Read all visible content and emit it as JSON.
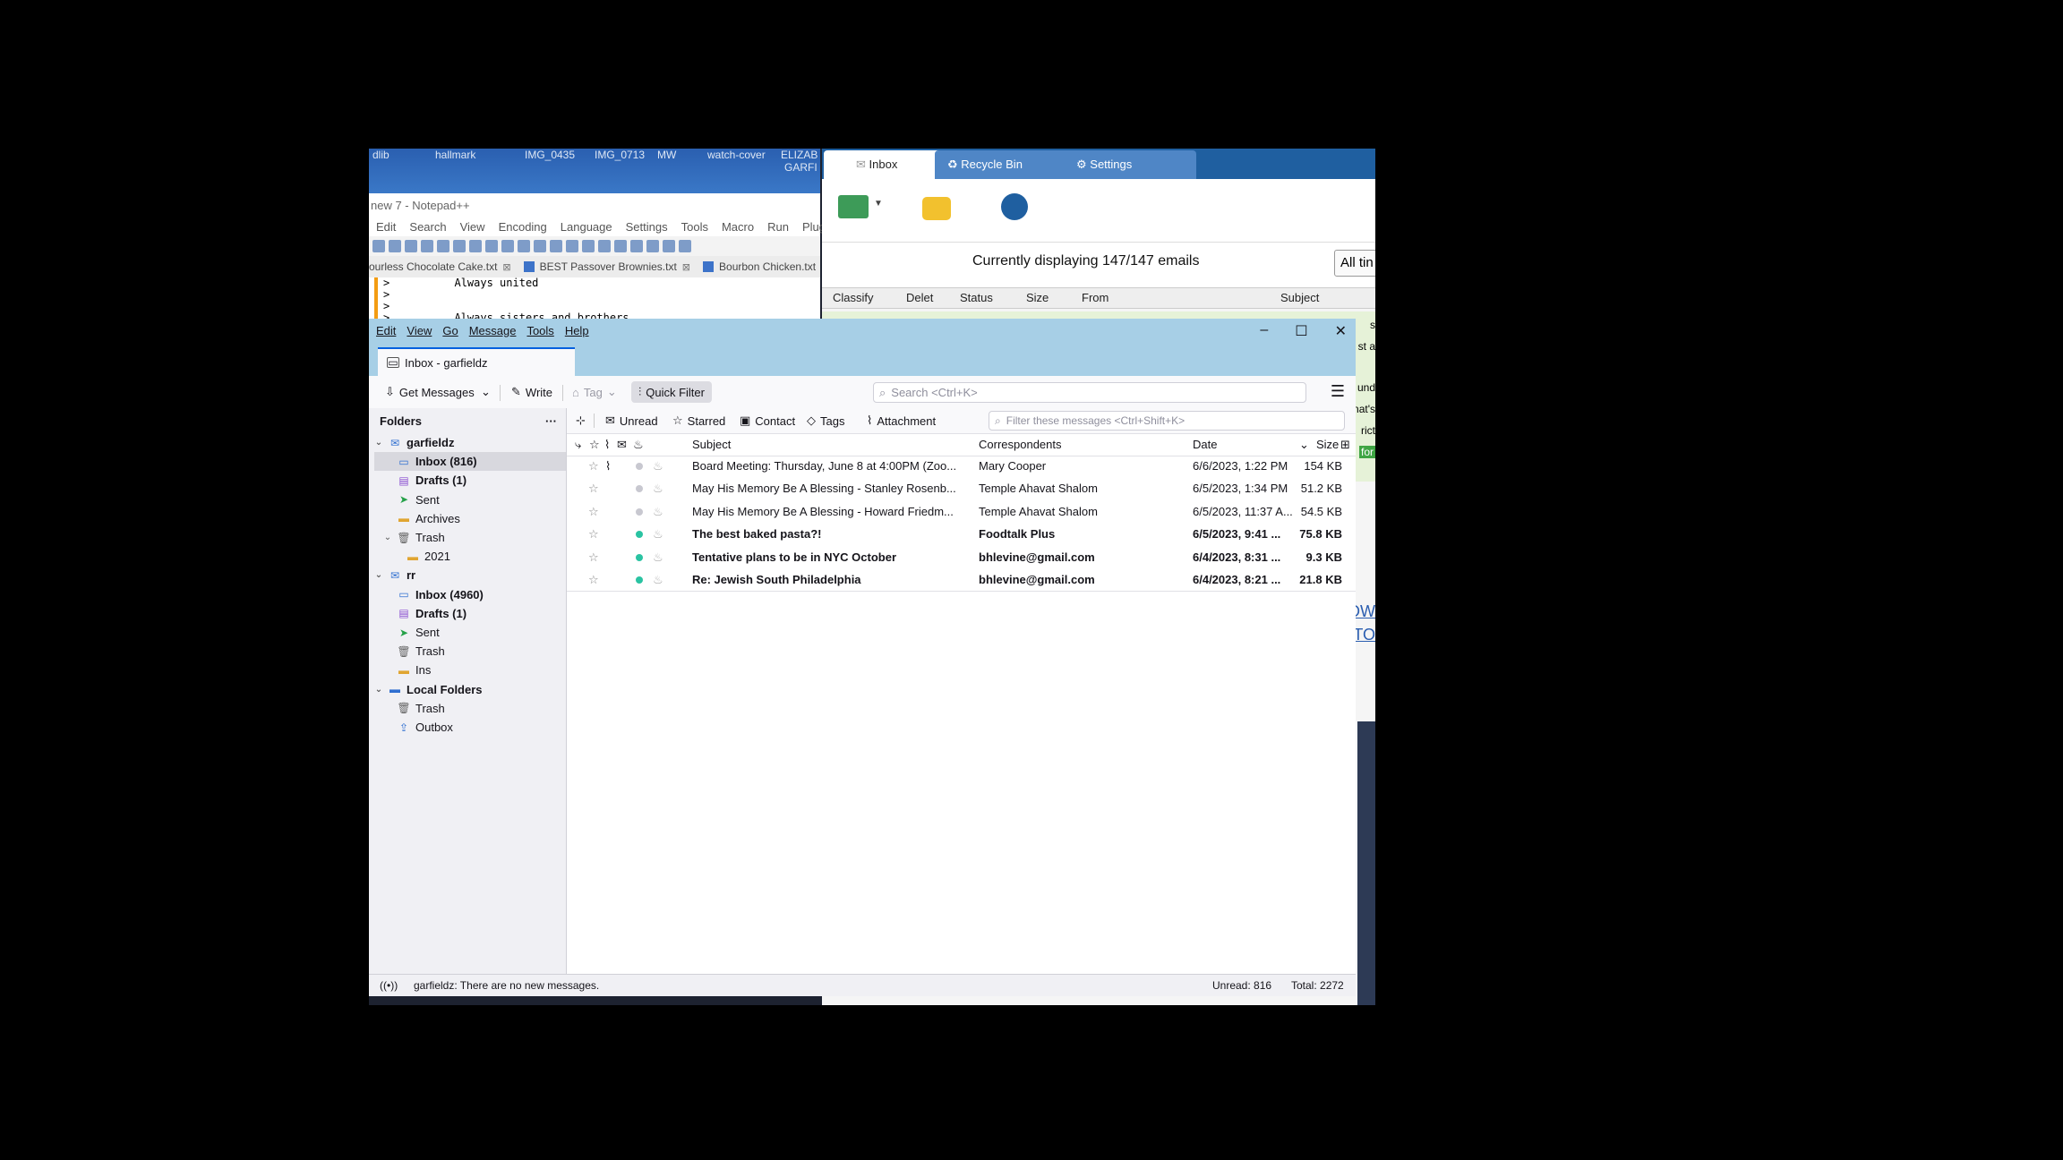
{
  "background": {
    "desktop_labels": [
      "dlib",
      "hallmark",
      "IMG_0435",
      "IMG_0713",
      "MW",
      "watch-cover",
      "ELIZAB",
      "GARFI"
    ],
    "notepad": {
      "title": "new 7 - Notepad++",
      "menu": [
        "Edit",
        "Search",
        "View",
        "Encoding",
        "Language",
        "Settings",
        "Tools",
        "Macro",
        "Run",
        "Plugins"
      ],
      "tabs": [
        "ourless Chocolate Cake.txt",
        "BEST Passover Brownies.txt",
        "Bourbon Chicken.txt"
      ],
      "lines": [
        ">          Always united",
        ">",
        ">",
        ">          Always sisters and brothers"
      ]
    },
    "mail_client": {
      "tabs": [
        "Inbox",
        "Recycle Bin",
        "Settings"
      ],
      "display_text": "Currently displaying 147/147 emails",
      "range_button": "All tin",
      "columns": [
        "Classify",
        "Delet",
        "Status",
        "Size",
        "From",
        "Subject"
      ],
      "right_snippets": [
        "s",
        "st a",
        "und",
        "nat's",
        "rict",
        "for",
        "OW",
        "TO"
      ]
    }
  },
  "thunderbird": {
    "menu": [
      "Edit",
      "View",
      "Go",
      "Message",
      "Tools",
      "Help"
    ],
    "window_controls": {
      "minimize": "–",
      "maximize": "☐",
      "close": "✕"
    },
    "tab_title": "Inbox - garfieldz",
    "toolbar": {
      "get_messages": "Get Messages",
      "write": "Write",
      "tag": "Tag",
      "quick_filter": "Quick Filter",
      "search_placeholder": "Search <Ctrl+K>"
    },
    "folders_header": "Folders",
    "folders": [
      {
        "label": "garfieldz",
        "icon": "account-icon",
        "depth": 0,
        "twisty": "v",
        "bold": true
      },
      {
        "label": "Inbox (816)",
        "icon": "inbox-icon",
        "depth": 1,
        "bold": true,
        "selected": true
      },
      {
        "label": "Drafts (1)",
        "icon": "drafts-icon",
        "depth": 1,
        "bold": true
      },
      {
        "label": "Sent",
        "icon": "sent-icon",
        "depth": 1
      },
      {
        "label": "Archives",
        "icon": "folder-icon",
        "depth": 1
      },
      {
        "label": "Trash",
        "icon": "trash-icon",
        "depth": 1,
        "twisty": "v"
      },
      {
        "label": "2021",
        "icon": "folder-icon",
        "depth": 2
      },
      {
        "label": "rr",
        "icon": "account-icon",
        "depth": 0,
        "twisty": "v",
        "bold": true
      },
      {
        "label": "Inbox (4960)",
        "icon": "inbox-icon",
        "depth": 1,
        "bold": true
      },
      {
        "label": "Drafts (1)",
        "icon": "drafts-icon",
        "depth": 1,
        "bold": true
      },
      {
        "label": "Sent",
        "icon": "sent-icon",
        "depth": 1
      },
      {
        "label": "Trash",
        "icon": "trash-icon",
        "depth": 1
      },
      {
        "label": "Ins",
        "icon": "folder-icon",
        "depth": 1
      },
      {
        "label": "Local Folders",
        "icon": "local-folder-icon",
        "depth": 0,
        "twisty": "v",
        "bold": true
      },
      {
        "label": "Trash",
        "icon": "trash-icon",
        "depth": 1
      },
      {
        "label": "Outbox",
        "icon": "outbox-icon",
        "depth": 1
      }
    ],
    "quick_filter": {
      "unread": "Unread",
      "starred": "Starred",
      "contact": "Contact",
      "tags": "Tags",
      "attachment": "Attachment",
      "filter_placeholder": "Filter these messages <Ctrl+Shift+K>"
    },
    "columns": {
      "subject": "Subject",
      "correspondents": "Correspondents",
      "date": "Date",
      "size": "Size"
    },
    "messages": [
      {
        "subject": "Board Meeting: Thursday, June 8 at 4:00PM (Zoo...",
        "from": "Mary Cooper",
        "date": "6/6/2023, 1:22 PM",
        "size": "154 KB",
        "unread": false,
        "attachment": true
      },
      {
        "subject": "May His Memory Be A Blessing - Stanley Rosenb...",
        "from": "Temple Ahavat Shalom",
        "date": "6/5/2023, 1:34 PM",
        "size": "51.2 KB",
        "unread": false,
        "attachment": false
      },
      {
        "subject": "May His Memory Be A Blessing - Howard Friedm...",
        "from": "Temple Ahavat Shalom",
        "date": "6/5/2023, 11:37 A...",
        "size": "54.5 KB",
        "unread": false,
        "attachment": false
      },
      {
        "subject": "The best baked pasta?!",
        "from": "Foodtalk Plus",
        "date": "6/5/2023, 9:41 ...",
        "size": "75.8 KB",
        "unread": true,
        "attachment": false
      },
      {
        "subject": "Tentative plans to be in NYC October",
        "from": "bhlevine@gmail.com",
        "date": "6/4/2023, 8:31 ...",
        "size": "9.3 KB",
        "unread": true,
        "attachment": false
      },
      {
        "subject": "Re: Jewish South Philadelphia",
        "from": "bhlevine@gmail.com",
        "date": "6/4/2023, 8:21 ...",
        "size": "21.8 KB",
        "unread": true,
        "attachment": false
      }
    ],
    "status": {
      "message": "garfieldz: There are no new messages.",
      "unread": "Unread: 816",
      "total": "Total: 2272"
    },
    "colors": {
      "titlebar": "#a7cfe6",
      "accent": "#0060df",
      "unread_dot": "#2ac3a2"
    }
  }
}
